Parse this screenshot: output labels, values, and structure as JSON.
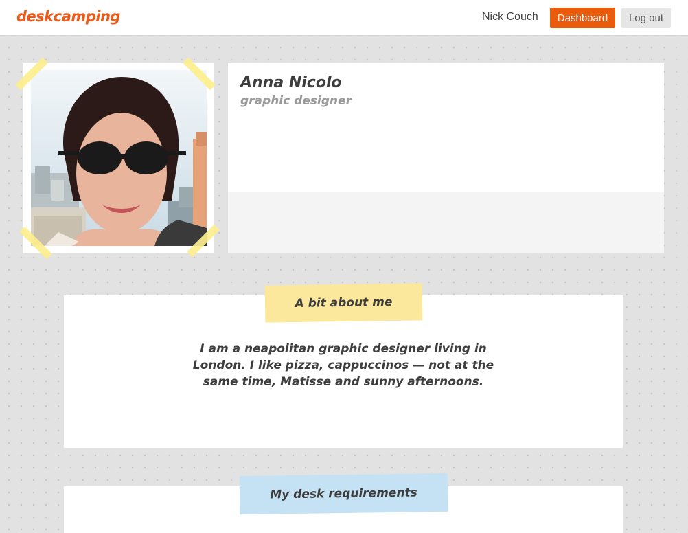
{
  "header": {
    "logo": "deskcamping",
    "username": "Nick Couch",
    "dashboard_label": "Dashboard",
    "logout_label": "Log out"
  },
  "profile": {
    "name": "Anna Nicolo",
    "title": "graphic designer",
    "photo_alt": "profile photo of a smiling woman in sunglasses"
  },
  "about": {
    "heading": "A bit about me",
    "text": "I am a neapolitan graphic designer living in London. I like pizza, cappuccinos — not at the same time, Matisse and sunny afternoons."
  },
  "desk": {
    "heading": "My desk requirements"
  },
  "colors": {
    "brand": "#ea5b1b",
    "dashboard_button": "#ea5b0c",
    "tape_yellow": "#fdee8c",
    "about_tag": "#fbe89c",
    "desk_tag": "#c5e2f4",
    "background": "#e2e2e2"
  }
}
